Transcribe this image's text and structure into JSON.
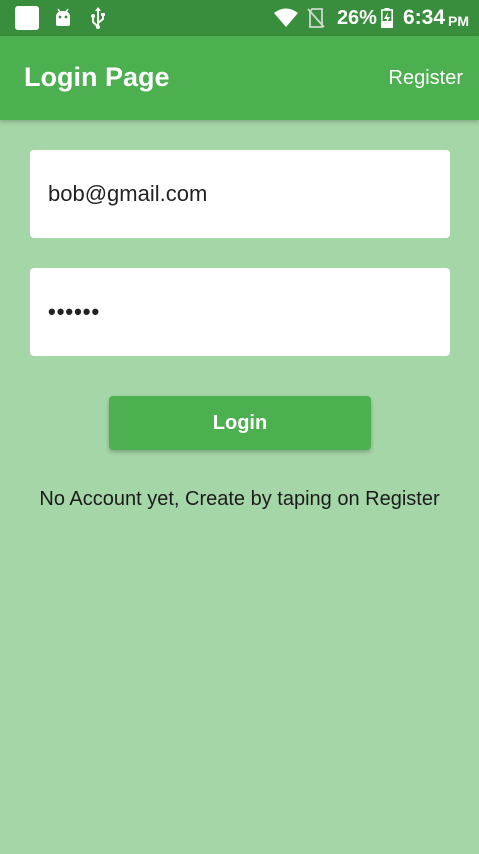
{
  "status_bar": {
    "battery_percent": "26%",
    "time": "6:34",
    "ampm": "PM",
    "icons": [
      "notification-square-icon",
      "android-icon",
      "usb-icon",
      "wifi-icon",
      "no-sim-icon",
      "battery-charging-icon"
    ]
  },
  "app_bar": {
    "title": "Login Page",
    "register_label": "Register",
    "color": "#4caf50"
  },
  "form": {
    "email_value": "bob@gmail.com",
    "password_value": "••••••",
    "login_label": "Login"
  },
  "hint": "No Account yet, Create by taping on Register",
  "colors": {
    "background": "#a5d6a7",
    "primary": "#4caf50",
    "status_bar": "#388e3c"
  }
}
